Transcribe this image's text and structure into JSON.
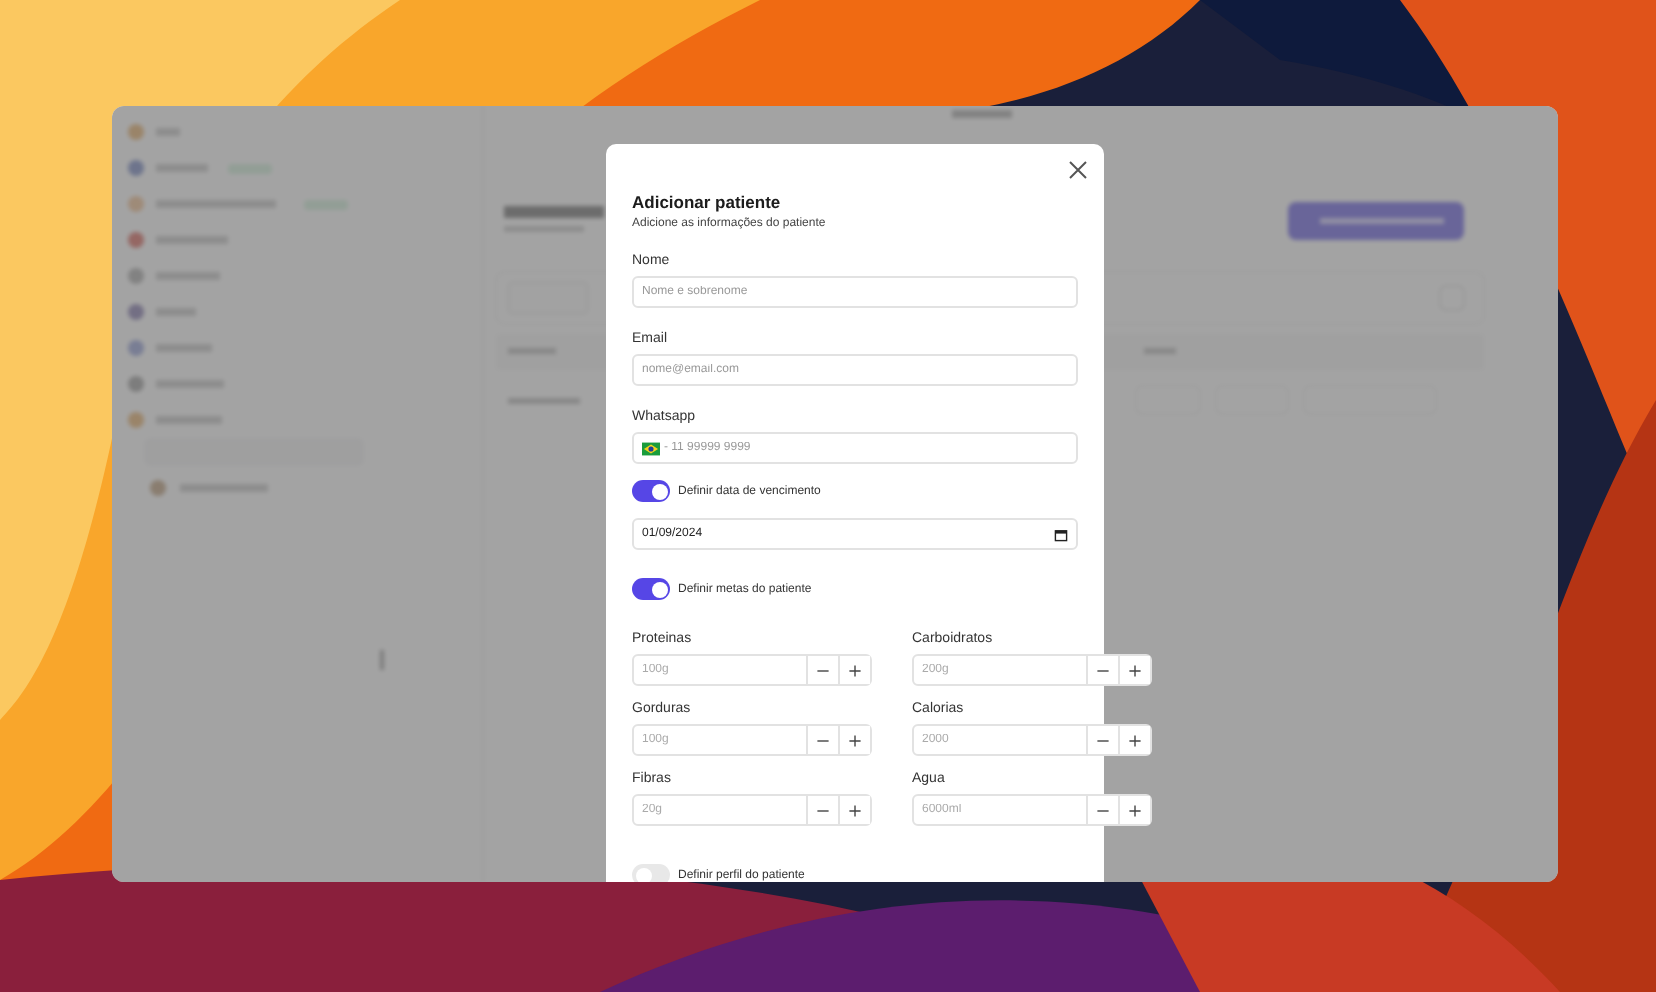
{
  "modal": {
    "title": "Adicionar patiente",
    "subtitle": "Adicione as informações do patiente",
    "sections": [
      {
        "kind": "field",
        "label": "Nome",
        "placeholder": "Nome e sobrenome"
      },
      {
        "kind": "field",
        "label": "Email",
        "placeholder": "nome@email.com"
      },
      {
        "kind": "phone",
        "label": "Whatsapp",
        "placeholder": "- 11 99999 9999"
      },
      {
        "kind": "toggle",
        "label": "Definir data de vencimento",
        "on": true
      },
      {
        "kind": "date",
        "value": "01/09/2024"
      },
      {
        "kind": "toggle",
        "label": "Definir metas do patiente",
        "on": true
      },
      {
        "kind": "goals",
        "items": [
          {
            "label": "Proteinas",
            "placeholder": "100g"
          },
          {
            "label": "Carboidratos",
            "placeholder": "200g"
          },
          {
            "label": "Gorduras",
            "placeholder": "100g"
          },
          {
            "label": "Calorias",
            "placeholder": "2000"
          },
          {
            "label": "Fibras",
            "placeholder": "20g"
          },
          {
            "label": "Agua",
            "placeholder": "6000ml"
          }
        ]
      },
      {
        "kind": "toggle",
        "label": "Definir perfil do patiente",
        "on": false
      }
    ]
  }
}
